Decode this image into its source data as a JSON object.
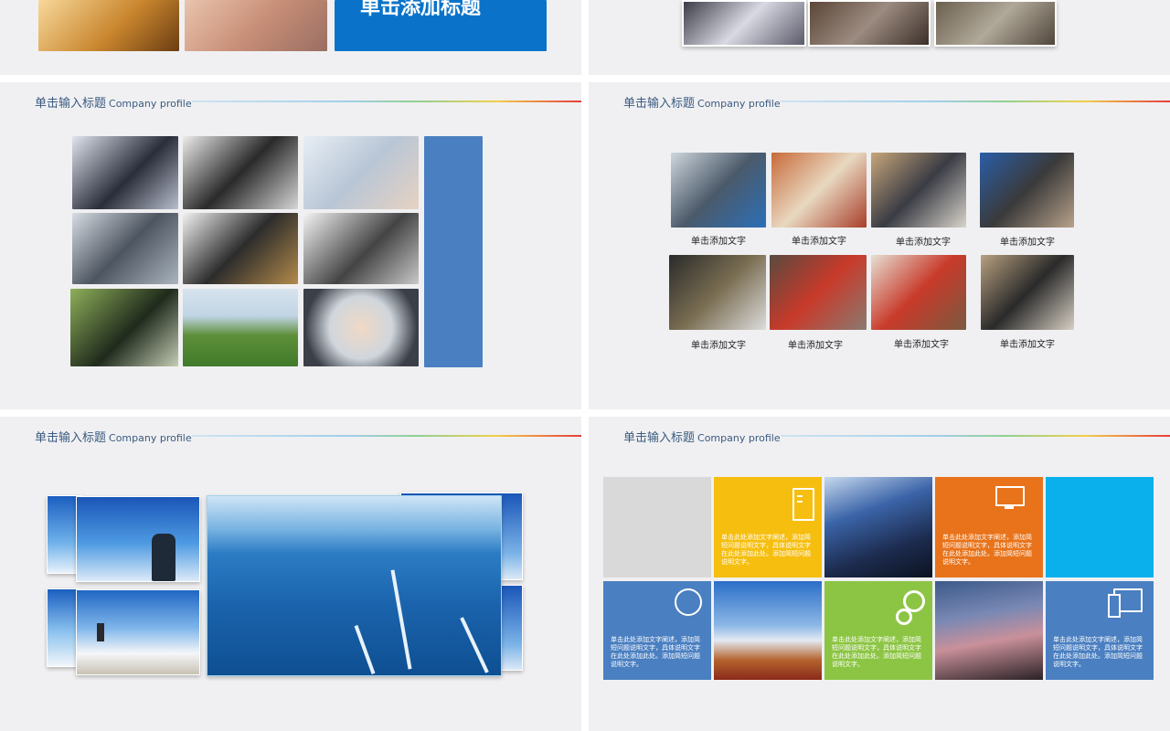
{
  "top_left": {
    "banner_text": "单击添加标题"
  },
  "slide_title": {
    "zh": "单击输入标题",
    "en": "Company profile"
  },
  "store_captions": [
    "单击添加文字",
    "单击添加文字",
    "单击添加文字",
    "单击添加文字",
    "单击添加文字",
    "单击添加文字",
    "单击添加文字",
    "单击添加文字"
  ],
  "metro_tiles": {
    "text_a": "单击此处添加文字阐述，添加简短问题说明文字，具体说明文字在此处添加此处。添加简短问题说明文字。",
    "text_b": "单击此处添加文字阐述，添加简短问题说明文字，具体说明文字在此处添加此处。添加简短问题说明文字。",
    "text_c": "单击此处添加文字阐述，添加简短问题说明文字，具体说明文字在此处添加此处。添加简短问题说明文字。",
    "text_d": "单击此处添加文字阐述，添加简短问题说明文字，具体说明文字在此处添加此处。添加简短问题说明文字。",
    "text_e": "单击此处添加文字阐述，添加简短问题说明文字，具体说明文字在此处添加此处。添加简短问题说明文字。"
  },
  "colors": {
    "blue": "#0a73c9",
    "steel_blue": "#4a7fc1",
    "yellow": "#f6be0f",
    "orange": "#e8731a",
    "cyan": "#0ab0ec",
    "green": "#8cc543",
    "gray": "#d9d9d9"
  }
}
